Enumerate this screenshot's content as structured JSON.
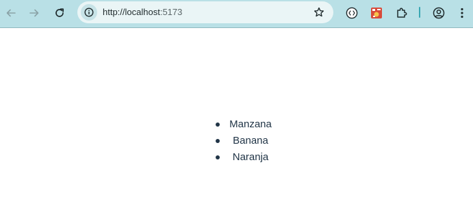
{
  "browser": {
    "url_host": "http://localhost",
    "url_port": ":5173",
    "icons": {
      "back": "arrow-left-icon",
      "forward": "arrow-right-icon",
      "reload": "reload-icon",
      "site_info": "info-icon",
      "bookmark": "star-icon",
      "extension_1": "code-brackets-icon",
      "extension_2": "red-extension-icon",
      "extensions": "puzzle-icon",
      "profile": "account-icon",
      "menu": "kebab-menu-icon"
    },
    "colors": {
      "toolbar": "#b9e0e6",
      "omnibox": "#eaf5f6",
      "separator": "#39a7b3"
    }
  },
  "page": {
    "list": [
      {
        "label": "Manzana"
      },
      {
        "label": "Banana"
      },
      {
        "label": "Naranja"
      }
    ],
    "text_color": "#213547"
  }
}
